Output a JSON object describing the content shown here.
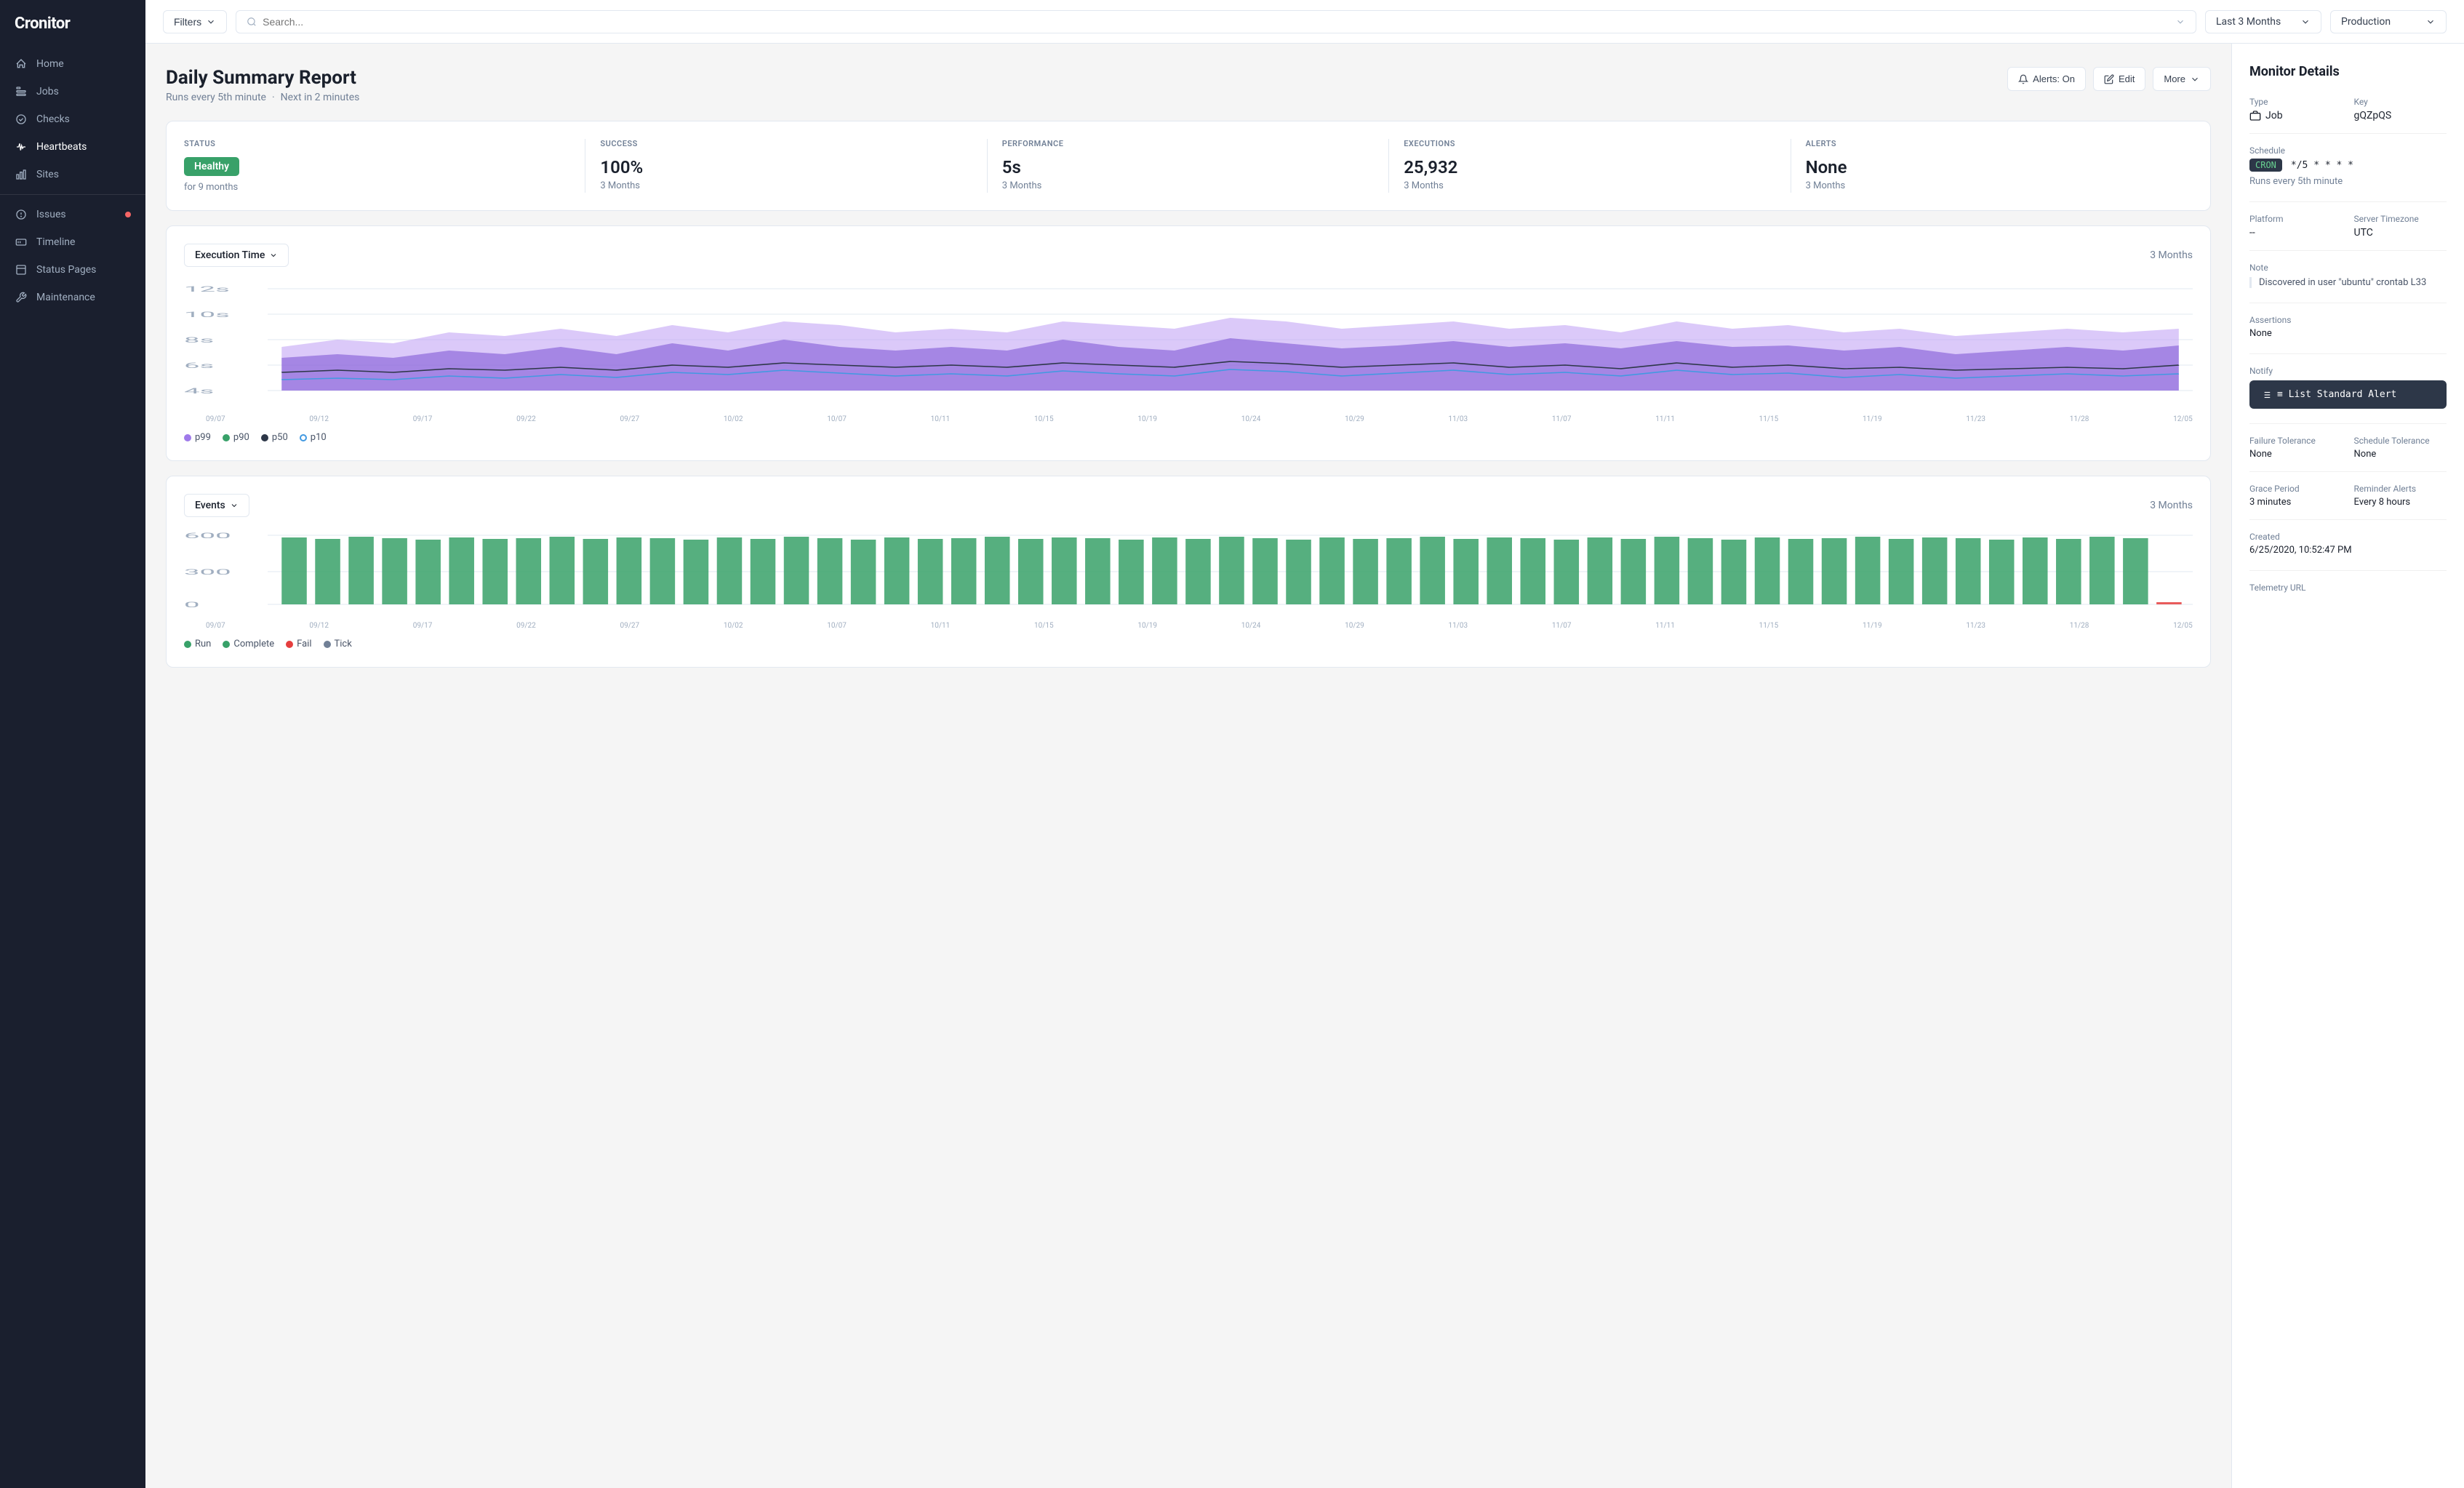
{
  "app": {
    "name": "Cronitor"
  },
  "sidebar": {
    "items": [
      {
        "id": "home",
        "label": "Home",
        "icon": "home",
        "active": false,
        "badge": false
      },
      {
        "id": "jobs",
        "label": "Jobs",
        "icon": "jobs",
        "active": false,
        "badge": false
      },
      {
        "id": "checks",
        "label": "Checks",
        "icon": "checks",
        "active": false,
        "badge": false
      },
      {
        "id": "heartbeats",
        "label": "Heartbeats",
        "icon": "heartbeats",
        "active": true,
        "badge": false
      },
      {
        "id": "sites",
        "label": "Sites",
        "icon": "sites",
        "active": false,
        "badge": false
      },
      {
        "id": "issues",
        "label": "Issues",
        "icon": "issues",
        "active": false,
        "badge": true
      },
      {
        "id": "timeline",
        "label": "Timeline",
        "icon": "timeline",
        "active": false,
        "badge": false
      },
      {
        "id": "status-pages",
        "label": "Status Pages",
        "icon": "status-pages",
        "active": false,
        "badge": false
      },
      {
        "id": "maintenance",
        "label": "Maintenance",
        "icon": "maintenance",
        "active": false,
        "badge": false
      }
    ]
  },
  "topbar": {
    "filters_label": "Filters",
    "search_placeholder": "Search...",
    "period_label": "Last 3 Months",
    "env_label": "Production"
  },
  "page": {
    "title": "Daily Summary Report",
    "subtitle_schedule": "Runs every 5th minute",
    "subtitle_next": "Next in 2 minutes",
    "actions": {
      "alerts": "Alerts: On",
      "edit": "Edit",
      "more": "More"
    }
  },
  "stats": {
    "status_label": "STATUS",
    "status_value": "Healthy",
    "status_sub": "for 9 months",
    "success_label": "SUCCESS",
    "success_value": "100%",
    "success_sub": "3 Months",
    "performance_label": "PERFORMANCE",
    "performance_value": "5s",
    "performance_sub": "3 Months",
    "executions_label": "EXECUTIONS",
    "executions_value": "25,932",
    "executions_sub": "3 Months",
    "alerts_label": "ALERTS",
    "alerts_value": "None",
    "alerts_sub": "3 Months"
  },
  "execution_chart": {
    "title": "Execution Time",
    "period": "3 Months",
    "y_labels": [
      "12s",
      "10s",
      "8s",
      "6s",
      "4s"
    ],
    "x_labels": [
      "09/07",
      "09/12",
      "09/17",
      "09/22",
      "09/27",
      "10/02",
      "10/07",
      "10/11",
      "10/15",
      "10/19",
      "10/24",
      "10/29",
      "11/03",
      "11/07",
      "11/11",
      "11/15",
      "11/19",
      "11/23",
      "11/28",
      "12/05"
    ],
    "legend": [
      {
        "id": "p99",
        "label": "p99",
        "color": "#9f7aea"
      },
      {
        "id": "p90",
        "label": "p90",
        "color": "#38a169"
      },
      {
        "id": "p50",
        "label": "p50",
        "color": "#2d3748"
      },
      {
        "id": "p10",
        "label": "p10",
        "color": "#4299e1"
      }
    ]
  },
  "events_chart": {
    "title": "Events",
    "period": "3 Months",
    "y_labels": [
      "600",
      "300",
      "0"
    ],
    "x_labels": [
      "09/07",
      "09/12",
      "09/17",
      "09/22",
      "09/27",
      "10/02",
      "10/07",
      "10/11",
      "10/15",
      "10/19",
      "10/24",
      "10/29",
      "11/03",
      "11/07",
      "11/11",
      "11/15",
      "11/19",
      "11/23",
      "11/28",
      "12/05"
    ],
    "legend": [
      {
        "id": "run",
        "label": "Run",
        "color": "#38a169"
      },
      {
        "id": "complete",
        "label": "Complete",
        "color": "#38a169"
      },
      {
        "id": "fail",
        "label": "Fail",
        "color": "#e53e3e"
      },
      {
        "id": "tick",
        "label": "Tick",
        "color": "#718096"
      }
    ]
  },
  "monitor_details": {
    "title": "Monitor Details",
    "type_label": "Type",
    "type_value": "Job",
    "key_label": "Key",
    "key_value": "gQZpQS",
    "schedule_label": "Schedule",
    "cron_badge": "CRON",
    "cron_value": "*/5  *  *  *  *",
    "schedule_desc": "Runs every 5th minute",
    "platform_label": "Platform",
    "platform_value": "--",
    "server_tz_label": "Server Timezone",
    "server_tz_value": "UTC",
    "note_label": "Note",
    "note_value": "Discovered in user \"ubuntu\" crontab L33",
    "assertions_label": "Assertions",
    "assertions_value": "None",
    "notify_label": "Notify",
    "notify_value": "≡  List   Standard Alert",
    "failure_tol_label": "Failure Tolerance",
    "failure_tol_value": "None",
    "schedule_tol_label": "Schedule Tolerance",
    "schedule_tol_value": "None",
    "grace_period_label": "Grace Period",
    "grace_period_value": "3 minutes",
    "reminder_label": "Reminder Alerts",
    "reminder_value": "Every 8 hours",
    "created_label": "Created",
    "created_value": "6/25/2020, 10:52:47 PM",
    "telemetry_label": "Telemetry URL"
  }
}
